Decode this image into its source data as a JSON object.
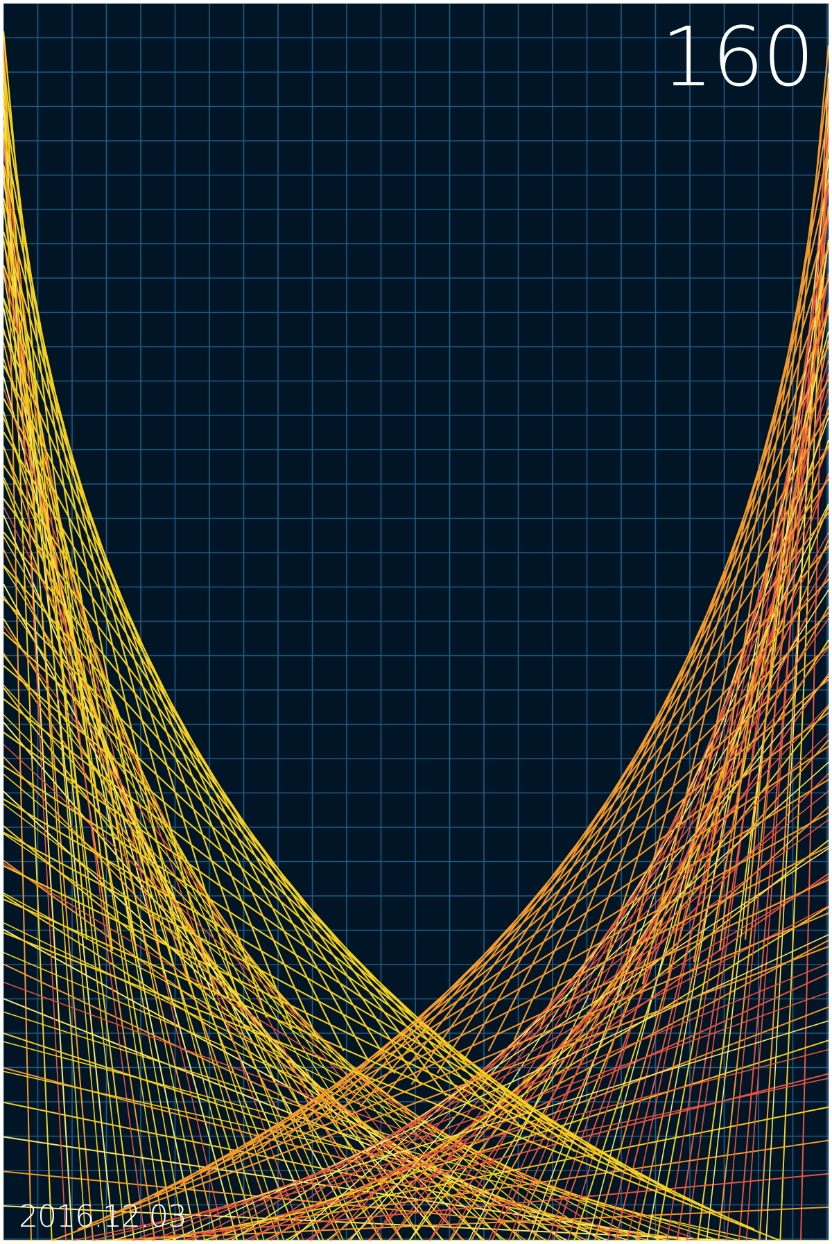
{
  "artwork": {
    "number": "160",
    "date": "2016.12.03"
  },
  "colors": {
    "background": "#001526",
    "grid": "#1f5d86",
    "string_yellow": "#f5d020",
    "string_yellow_light": "#ffe86a",
    "string_orange": "#f59a2c",
    "string_red": "#e8553f",
    "text": "#ffffff"
  }
}
